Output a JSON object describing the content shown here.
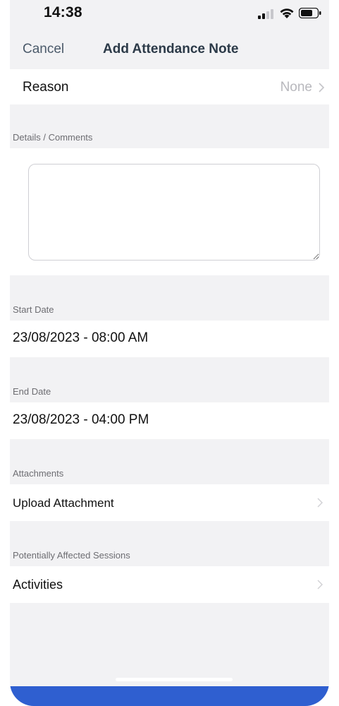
{
  "status_bar": {
    "time": "14:38"
  },
  "nav": {
    "cancel_label": "Cancel",
    "title": "Add Attendance Note"
  },
  "reason": {
    "label": "Reason",
    "value": "None"
  },
  "details": {
    "header": "Details / Comments",
    "value": ""
  },
  "start_date": {
    "header": "Start Date",
    "value": "23/08/2023 - 08:00 AM"
  },
  "end_date": {
    "header": "End Date",
    "value": "23/08/2023 - 04:00 PM"
  },
  "attachments": {
    "header": "Attachments",
    "upload_label": "Upload Attachment"
  },
  "sessions": {
    "header": "Potentially Affected Sessions",
    "activities_label": "Activities"
  },
  "colors": {
    "background": "#f2f2f4",
    "row": "#ffffff",
    "nav_title": "#2c3a48",
    "cancel": "#4b5a6a",
    "value_gray": "#b8b8bd",
    "home_bar": "#2f5fd0"
  }
}
